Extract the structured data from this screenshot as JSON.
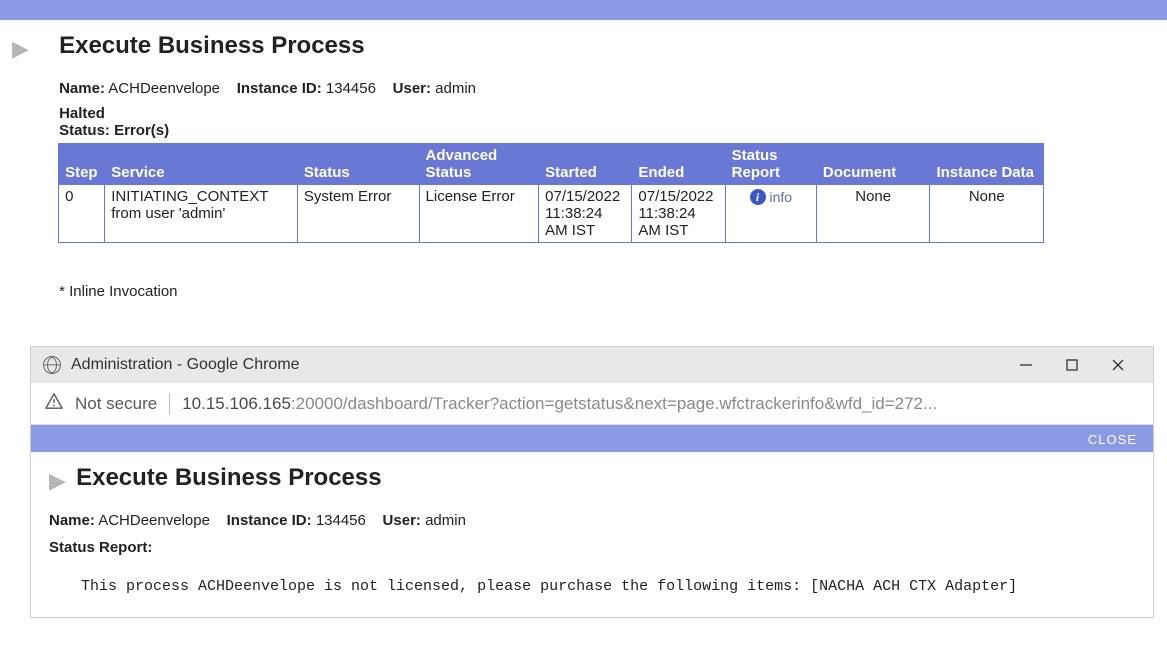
{
  "page_title": "Execute Business Process",
  "header": {
    "name_label": "Name:",
    "name_value": "ACHDeenvelope",
    "instance_label": "Instance ID:",
    "instance_value": "134456",
    "user_label": "User:",
    "user_value": "admin"
  },
  "halt": {
    "halted_text": "Halted",
    "status_label": "Status:",
    "status_value": "Error(s)"
  },
  "table": {
    "columns": {
      "step": "Step",
      "service": "Service",
      "status": "Status",
      "adv_status": "Advanced Status",
      "started": "Started",
      "ended": "Ended",
      "status_report": "Status Report",
      "document": "Document",
      "instance_data": "Instance Data"
    },
    "row": {
      "step": "0",
      "service": "INITIATING_CONTEXT from user 'admin'",
      "status": "System Error",
      "adv_status": "License Error",
      "started": "07/15/2022 11:38:24 AM IST",
      "ended": "07/15/2022 11:38:24 AM IST",
      "status_report_link": "info",
      "document": "None",
      "instance_data": "None"
    }
  },
  "footnote": "* Inline Invocation",
  "popup": {
    "window_title": "Administration - Google Chrome",
    "address": {
      "not_secure": "Not secure",
      "host": "10.15.106.165",
      "port_path": ":20000/dashboard/Tracker?action=getstatus&next=page.wfctrackerinfo&wfd_id=272...",
      "close_label": "CLOSE"
    },
    "page_title": "Execute Business Process",
    "header": {
      "name_label": "Name:",
      "name_value": "ACHDeenvelope",
      "instance_label": "Instance ID:",
      "instance_value": "134456",
      "user_label": "User:",
      "user_value": "admin"
    },
    "status_report_label": "Status Report:",
    "status_report_message": "This process ACHDeenvelope is not licensed, please purchase the following items: [NACHA ACH CTX Adapter]"
  }
}
